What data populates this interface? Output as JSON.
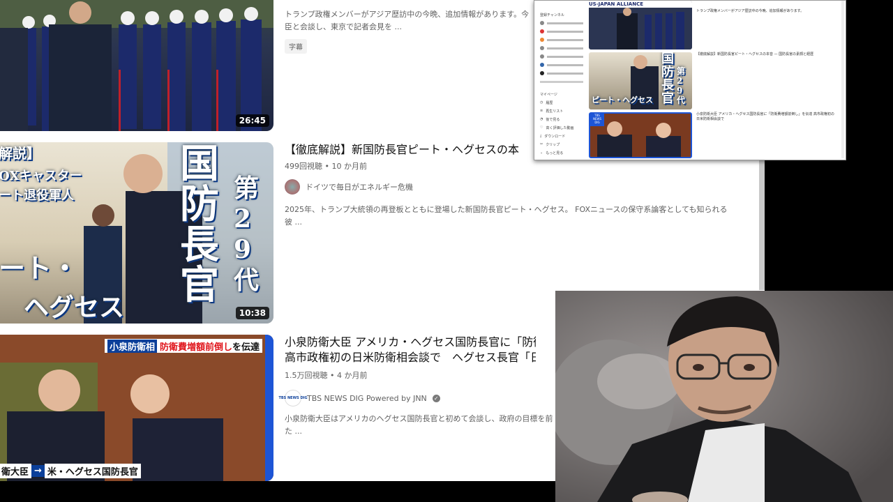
{
  "videos": [
    {
      "duration": "26:45",
      "desc": "トランプ政権メンバーがアジア歴訪中の今晩、追加情報があります。今",
      "desc2": "臣と会談し、東京で記者会見を ...",
      "chip": "字幕"
    },
    {
      "title": "【徹底解説】新国防長官ピート・ヘグセスの本",
      "meta": "499回視聴 • 10 か月前",
      "channel": "ドイツで毎日がエネルギー危機",
      "desc": "2025年、トランプ大統領の再登板とともに登場した新国防長官ピート・ヘグセス。 FOXニュースの保守系論客としても知られる",
      "desc2": "彼 ...",
      "duration": "10:38",
      "thumb_left_top": "解説】",
      "thumb_left_mid1": "OXキャスター",
      "thumb_left_mid2": "ート退役軍人",
      "thumb_big": "国防長官",
      "thumb_side": "第29代",
      "thumb_bottom1": "ート・",
      "thumb_bottom2": "ヘグセス"
    },
    {
      "title": "小泉防衛大臣 アメリカ・ヘグセス国防長官に「防衛",
      "title2": "高市政権初の日米防衛相会談で　ヘグセス長官「日",
      "meta": "1.5万回視聴 • 4 か月前",
      "channel": "TBS NEWS DIG Powered by JNN",
      "channel_logo": "TBS NEWS DIG",
      "desc": "小泉防衛大臣はアメリカのヘグセス国防長官と初めて会談し、政府の目標を前",
      "desc2": "た ...",
      "banner_a": "小泉防衛相",
      "banner_b": "防衛費増額前倒し",
      "banner_c": "を伝達",
      "lower_a": "衛大臣",
      "lower_b": "米・ヘグセス国防長官"
    }
  ],
  "mini_window": {
    "header_text": "US-JAPAN ALLIANCE",
    "side_items": [
      "登録チャンネル",
      "",
      "",
      "",
      "",
      "",
      "",
      "",
      "",
      "",
      "マイページ",
      "履歴",
      "再生リスト",
      "後で見る",
      "高く評価した動画",
      "ダウンロード",
      "クリップ",
      "もっと見る"
    ],
    "items": [
      {
        "text": "トランプ政権メンバーがアジア歴訪中の今晩、追加情報があります。"
      },
      {
        "text": "【徹底解説】新国防長官ピート・ヘグセスの本音 — 国防長官の素顔と経歴",
        "thumb_big": "国防長官",
        "thumb_side": "第29代",
        "thumb_bottom": "ピート・ヘグセス"
      },
      {
        "text": "小泉防衛大臣 アメリカ・ヘグセス国防長官に「防衛費増額前倒し」を伝達 高市政権初の日米防衛相会談で",
        "logo": "TBS NEWS DIG"
      }
    ]
  },
  "colors": {
    "accent_blue": "#0b3f9a",
    "banner_red": "#e0141b",
    "webcam_bg": "#6b6868"
  }
}
